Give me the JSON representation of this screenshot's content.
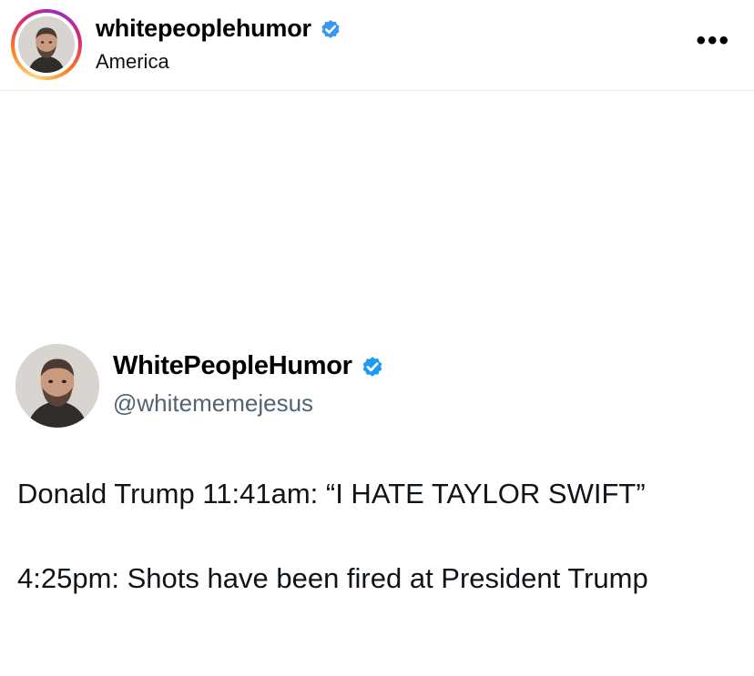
{
  "post_header": {
    "username": "whitepeoplehumor",
    "location": "America",
    "more_label": "•••",
    "verified_icon": "verified-badge-icon",
    "accent": "#3897f0"
  },
  "tweet": {
    "display_name": "WhitePeopleHumor",
    "handle": "@whitememejesus",
    "lines": [
      "Donald Trump 11:41am: “I HATE TAYLOR SWIFT”",
      "4:25pm: Shots have been fired at President Trump"
    ],
    "verified_icon": "verified-badge-icon",
    "accent": "#1d9bf0"
  }
}
